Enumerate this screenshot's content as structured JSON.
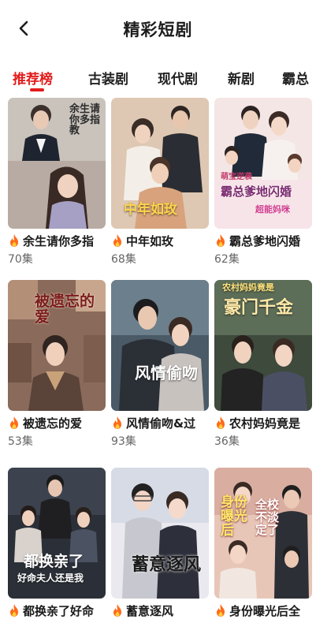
{
  "header": {
    "title": "精彩短剧"
  },
  "tabs": [
    {
      "label": "推荐榜",
      "active": true
    },
    {
      "label": "古装剧",
      "active": false
    },
    {
      "label": "现代剧",
      "active": false
    },
    {
      "label": "新剧",
      "active": false
    },
    {
      "label": "霸总",
      "active": false
    }
  ],
  "dramas": [
    {
      "title": "余生请你多指",
      "episodes": "70集",
      "poster_text": "余生请你多指教"
    },
    {
      "title": "中年如玫",
      "episodes": "68集",
      "poster_text": "中年如玫"
    },
    {
      "title": "霸总爹地闪婚",
      "episodes": "62集",
      "poster_text": "霸总爹地闪婚",
      "poster_subtext": "超能妈咪",
      "poster_tag": "萌宝逆袭"
    },
    {
      "title": "被遗忘的爱",
      "episodes": "53集",
      "poster_text": "被遗忘的爱"
    },
    {
      "title": "风情偷吻&过",
      "episodes": "93集",
      "poster_text": "风情偷吻"
    },
    {
      "title": "农村妈妈竟是",
      "episodes": "36集",
      "poster_text": "豪门千金",
      "poster_tag": "农村妈妈竟是"
    },
    {
      "title": "都换亲了好命",
      "episodes": "",
      "poster_text": "都换亲了",
      "poster_subtext": "好命夫人还是我"
    },
    {
      "title": "蓄意逐风",
      "episodes": "",
      "poster_text": "蓄意逐风"
    },
    {
      "title": "身份曝光后全",
      "episodes": "",
      "poster_text": "身份曝光后",
      "poster_subtext": "全校不淡定了"
    }
  ],
  "colors": {
    "accent": "#e21c1c",
    "fire": "#ff6a1a"
  }
}
